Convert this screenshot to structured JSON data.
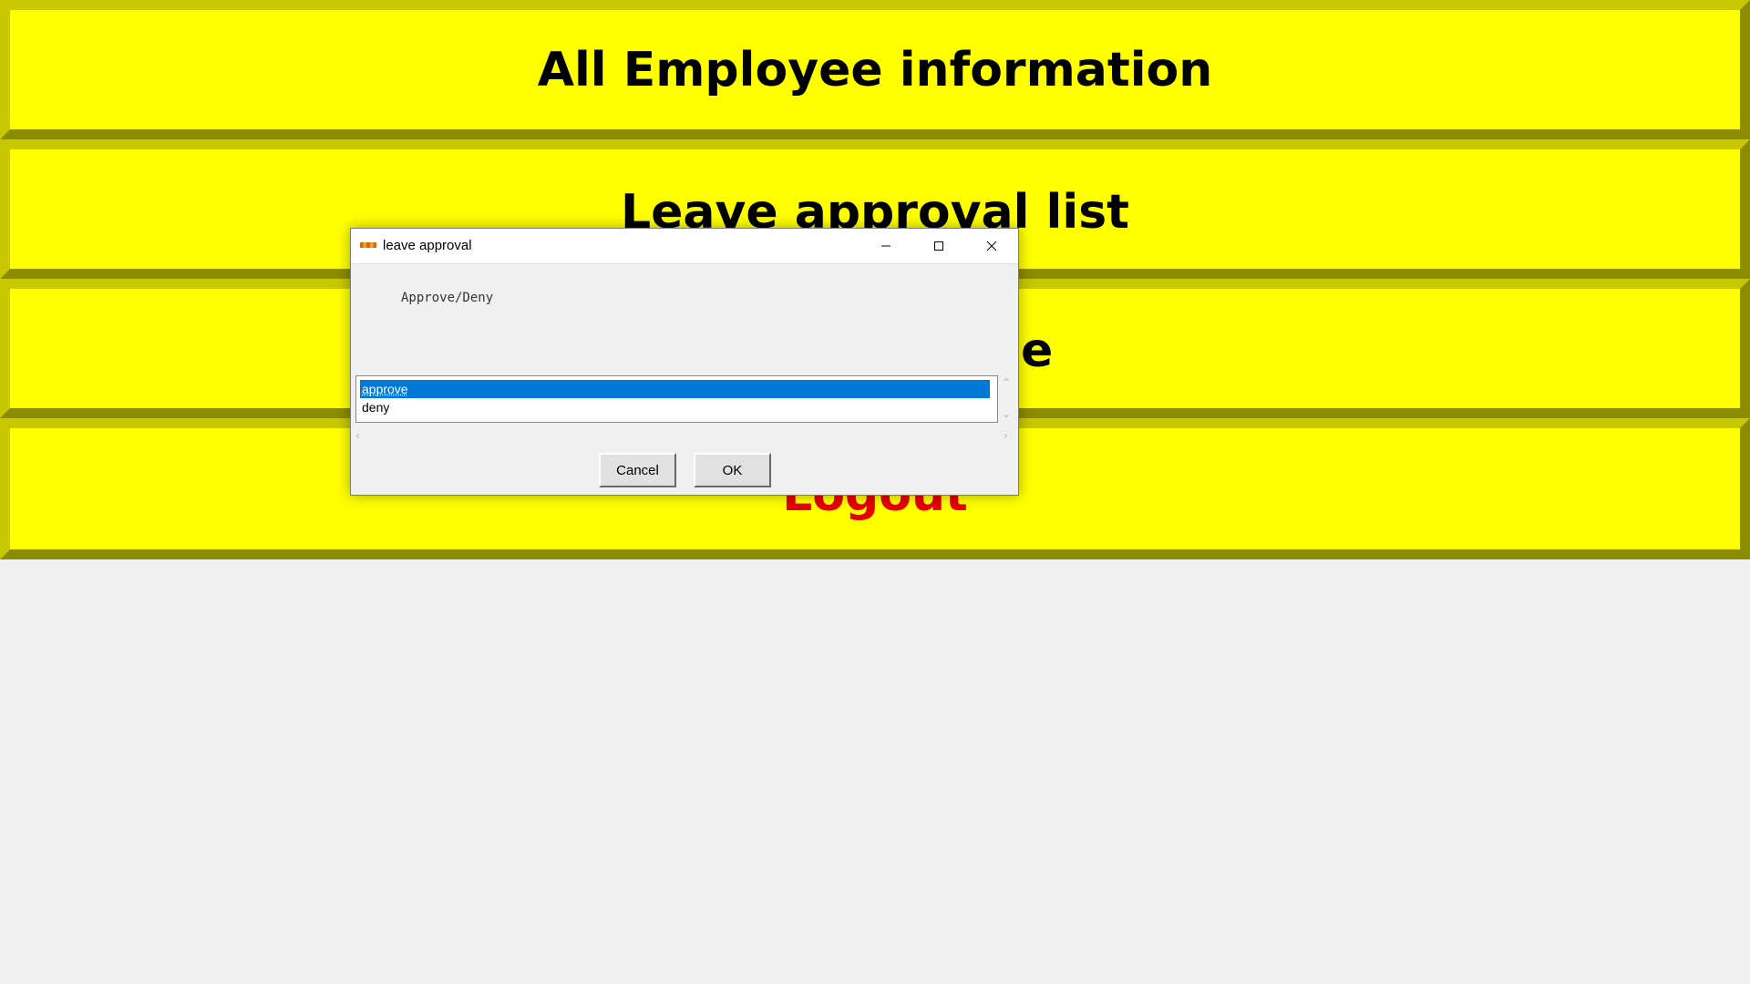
{
  "menu": {
    "employee_info": "All Employee information",
    "leave_approval_list": "Leave approval list",
    "third_button_visible_fragment": "e",
    "logout": "Logout"
  },
  "dialog": {
    "title": "leave approval",
    "prompt": "Approve/Deny",
    "options": [
      "approve",
      "deny"
    ],
    "selected_option": "approve",
    "cancel_label": "Cancel",
    "ok_label": "OK"
  },
  "colors": {
    "button_bg": "#ffff00",
    "logout_text": "#e60000",
    "selection": "#0078d7"
  },
  "icons": {
    "minimize": "minimize-icon",
    "maximize": "maximize-icon",
    "close": "close-icon"
  }
}
